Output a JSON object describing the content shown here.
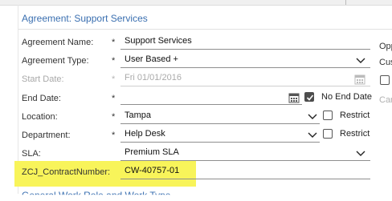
{
  "section": {
    "title": "Agreement: Support Services",
    "next_section_title": "General Work Role and Work Type"
  },
  "fields": {
    "agreement_name": {
      "label": "Agreement Name:",
      "required": "*",
      "value": "Support Services"
    },
    "agreement_type": {
      "label": "Agreement Type:",
      "required": "*",
      "value": "User Based +"
    },
    "start_date": {
      "label": "Start Date:",
      "required": "*",
      "value": "Fri 01/01/2016"
    },
    "end_date": {
      "label": "End Date:",
      "required": "*",
      "value": "",
      "no_end_date_label": "No End Date",
      "no_end_date_checked": true
    },
    "location": {
      "label": "Location:",
      "required": "*",
      "value": "Tampa",
      "restrict_label": "Restrict"
    },
    "department": {
      "label": "Department:",
      "required": "*",
      "value": "Help Desk",
      "restrict_label": "Restrict"
    },
    "sla": {
      "label": "SLA:",
      "value": "Premium SLA"
    },
    "contract_number": {
      "label": "ZCJ_ContractNumber:",
      "value": "CW-40757-01"
    }
  },
  "right_column": {
    "opp_label": "Opp",
    "cus_label": "Cus",
    "car_label": "Car"
  },
  "colors": {
    "accent": "#3a6fb0",
    "highlight": "#f8f45a"
  },
  "icons": [
    "chevron-down-icon",
    "calendar-icon",
    "checkbox-icon"
  ]
}
